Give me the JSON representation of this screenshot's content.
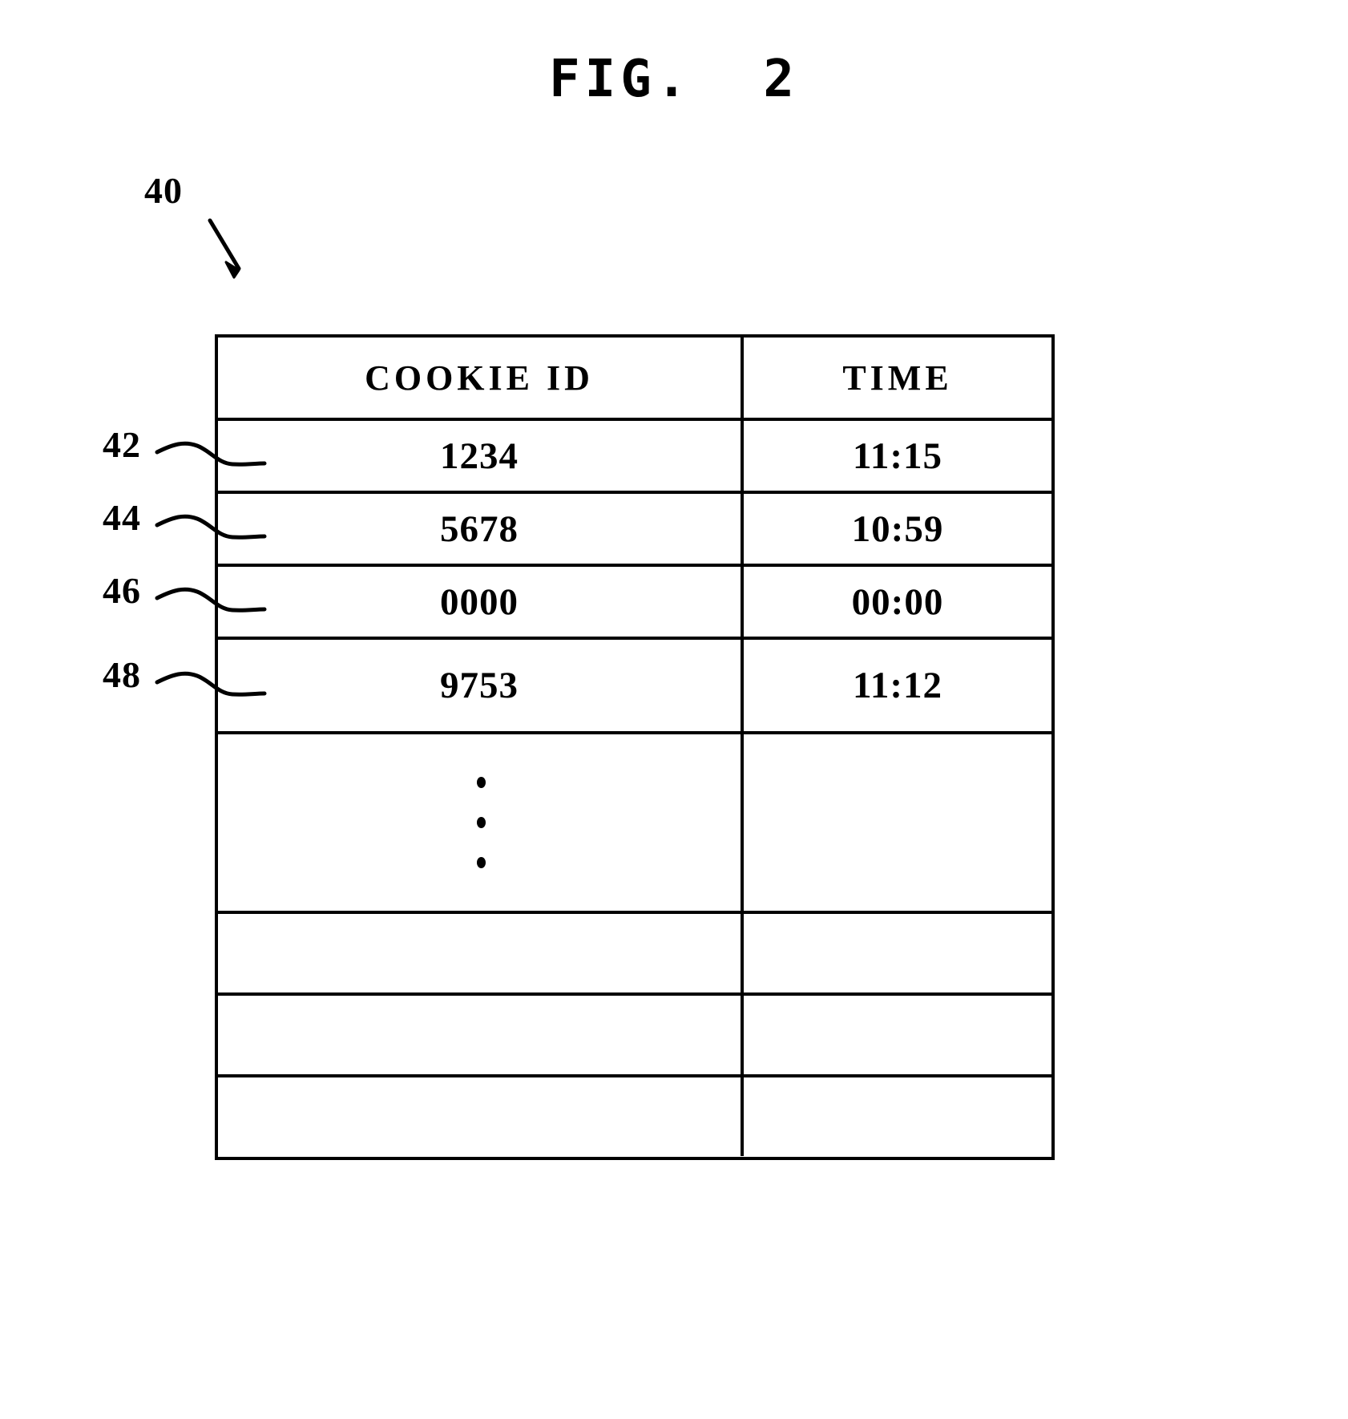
{
  "figure": {
    "title": "FIG.  2",
    "diagram_reference": "40"
  },
  "table": {
    "headers": {
      "cookie_id": "COOKIE ID",
      "time": "TIME"
    },
    "rows": [
      {
        "ref": "42",
        "cookie_id": "1234",
        "time": "11:15"
      },
      {
        "ref": "44",
        "cookie_id": "5678",
        "time": "10:59"
      },
      {
        "ref": "46",
        "cookie_id": "0000",
        "time": "00:00"
      },
      {
        "ref": "48",
        "cookie_id": "9753",
        "time": "11:12"
      }
    ],
    "continuation": {
      "indicator": "vertical-ellipsis",
      "cookie_id": "",
      "time": ""
    },
    "empty_rows": [
      {
        "cookie_id": "",
        "time": ""
      },
      {
        "cookie_id": "",
        "time": ""
      },
      {
        "cookie_id": "",
        "time": ""
      }
    ]
  },
  "colors": {
    "ink": "#000000",
    "paper": "#ffffff"
  }
}
